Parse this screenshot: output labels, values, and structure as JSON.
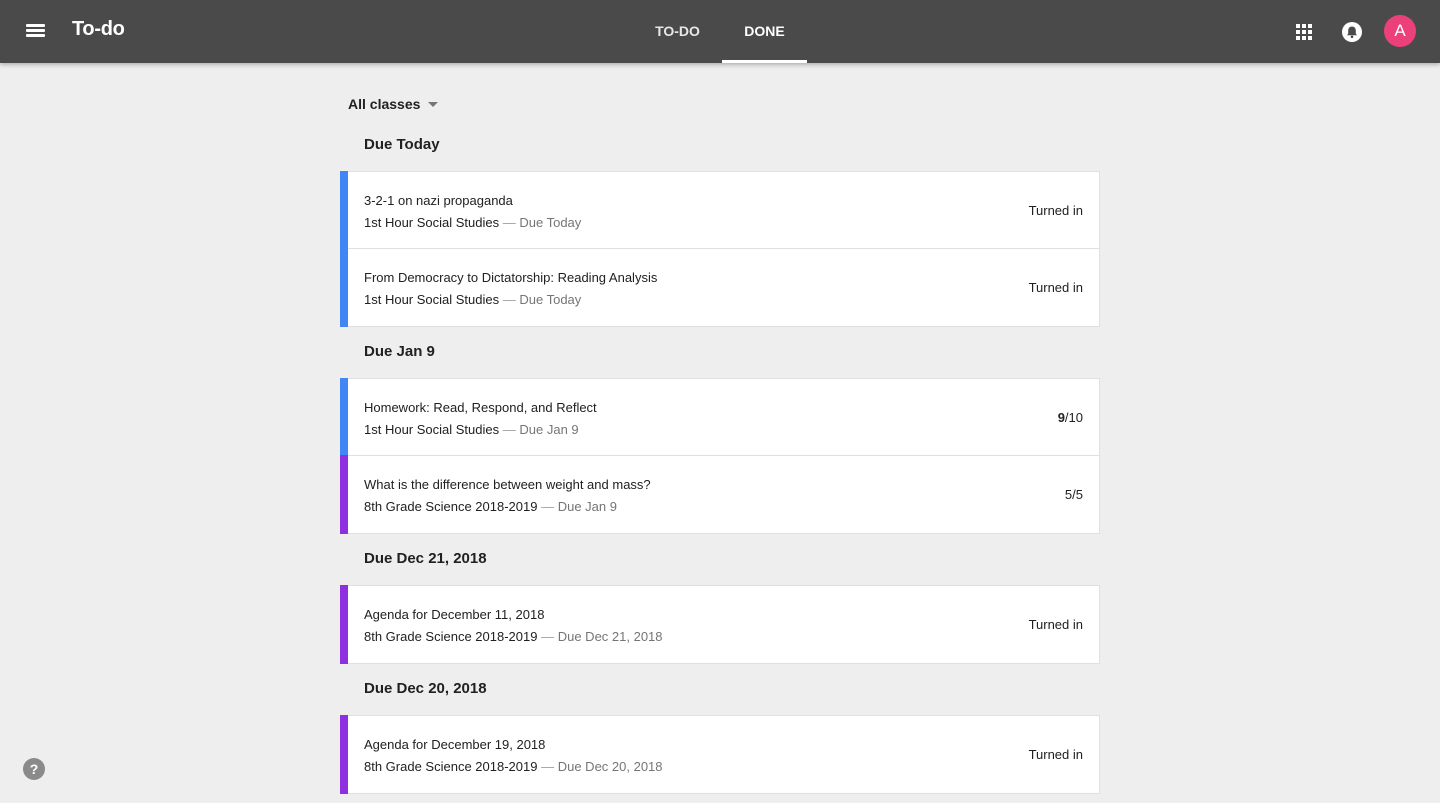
{
  "header": {
    "title": "To-do",
    "tabs": [
      {
        "label": "TO-DO",
        "active": false
      },
      {
        "label": "DONE",
        "active": true
      }
    ],
    "avatar_initial": "A",
    "avatar_color": "#ec407a",
    "icons": [
      "menu-icon",
      "apps-grid-icon",
      "notifications-bell-icon"
    ]
  },
  "filter": {
    "label": "All classes"
  },
  "colors": {
    "social_studies": "#4285f4",
    "science": "#8e2fe0"
  },
  "sections": [
    {
      "title": "Due Today",
      "items": [
        {
          "title": "3-2-1 on nazi propaganda",
          "class": "1st Hour Social Studies",
          "separator": "—",
          "due": "Due Today",
          "status": "Turned in",
          "color": "#4285f4"
        },
        {
          "title": "From Democracy to Dictatorship: Reading Analysis",
          "class": "1st Hour Social Studies",
          "separator": "—",
          "due": "Due Today",
          "status": "Turned in",
          "color": "#4285f4"
        }
      ]
    },
    {
      "title": "Due Jan 9",
      "items": [
        {
          "title": "Homework: Read, Respond, and Reflect",
          "class": "1st Hour Social Studies",
          "separator": "—",
          "due": "Due Jan 9",
          "grade": "9",
          "grade_total": "/10",
          "color": "#4285f4"
        },
        {
          "title": "What is the difference between weight and mass?",
          "class": "8th Grade Science 2018-2019",
          "separator": "—",
          "due": "Due Jan 9",
          "status": "5/5",
          "color": "#8e2fe0"
        }
      ]
    },
    {
      "title": "Due Dec 21, 2018",
      "items": [
        {
          "title": "Agenda for December 11, 2018",
          "class": "8th Grade Science 2018-2019",
          "separator": "—",
          "due": "Due Dec 21, 2018",
          "status": "Turned in",
          "color": "#8e2fe0"
        }
      ]
    },
    {
      "title": "Due Dec 20, 2018",
      "items": [
        {
          "title": "Agenda for December 19, 2018",
          "class": "8th Grade Science 2018-2019",
          "separator": "—",
          "due": "Due Dec 20, 2018",
          "status": "Turned in",
          "color": "#8e2fe0"
        }
      ]
    }
  ],
  "help": {
    "label": "?"
  }
}
